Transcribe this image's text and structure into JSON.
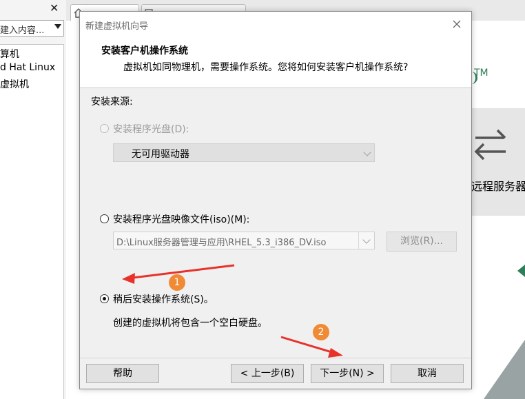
{
  "background": {
    "search_placeholder": "键入内容...",
    "search_visible": "建入内容...",
    "tree_items": [
      "算机",
      "d Hat Linux",
      "虚拟机"
    ],
    "tile_label": "远程服务器",
    "trademark": "TM",
    "icons": [
      "close-icon",
      "dropdown-icon",
      "home-tab-icon",
      "transfer-arrows-icon"
    ]
  },
  "dialog": {
    "title": "新建虚拟机向导",
    "header_title": "安装客户机操作系统",
    "header_subtitle": "虚拟机如同物理机，需要操作系统。您将如何安装客户机操作系统?",
    "source_label": "安装来源:",
    "options": {
      "disc": {
        "label": "安装程序光盘(D):",
        "enabled": false,
        "selected": false
      },
      "disc_combo_value": "无可用驱动器",
      "iso": {
        "label": "安装程序光盘映像文件(iso)(M):",
        "enabled": true,
        "selected": false
      },
      "iso_combo_value": "D:\\Linux服务器管理与应用\\RHEL_5.3_i386_DV.iso",
      "browse_label": "浏览(R)...",
      "later": {
        "label": "稍后安装操作系统(S)。",
        "enabled": true,
        "selected": true
      },
      "later_desc": "创建的虚拟机将包含一个空白硬盘。"
    },
    "buttons": {
      "help": "帮助",
      "back": "< 上一步(B)",
      "next": "下一步(N) >",
      "cancel": "取消"
    }
  },
  "annotations": {
    "badge1": "1",
    "badge2": "2",
    "color": "#f08a35",
    "arrow_color": "#e8312a"
  }
}
